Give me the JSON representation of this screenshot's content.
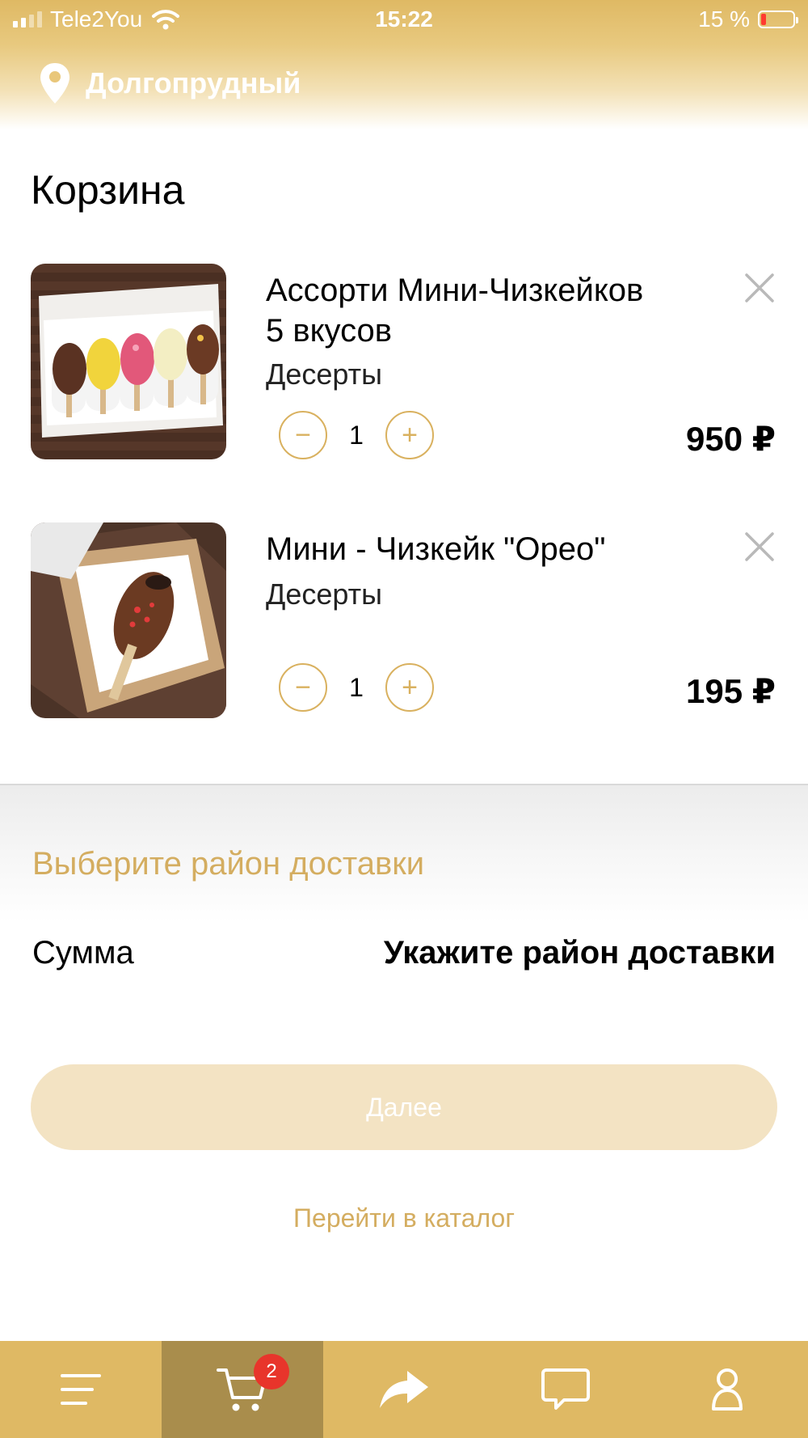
{
  "status_bar": {
    "carrier": "Tele2You",
    "time": "15:22",
    "battery": "15 %",
    "battery_level": 0.15
  },
  "header": {
    "city": "Долгопрудный"
  },
  "page": {
    "title": "Корзина"
  },
  "cart": {
    "items": [
      {
        "name_line1": "Ассорти Мини-Чизкейков",
        "name_line2": "5 вкусов",
        "category": "Десерты",
        "quantity": "1",
        "price": "950 ₽",
        "minus": "−",
        "plus": "+"
      },
      {
        "name_line1": "Мини - Чизкейк \"Орео\"",
        "category": "Десерты",
        "quantity": "1",
        "price": "195 ₽",
        "minus": "−",
        "plus": "+"
      }
    ]
  },
  "delivery": {
    "choose_district": "Выберите район доставки"
  },
  "summary": {
    "label": "Сумма",
    "value": "Укажите район доставки"
  },
  "actions": {
    "next": "Далее",
    "catalog": "Перейти в каталог"
  },
  "bottom_nav": {
    "items": [
      {
        "icon": "menu-icon"
      },
      {
        "icon": "cart-icon",
        "badge": "2",
        "active": true
      },
      {
        "icon": "share-icon"
      },
      {
        "icon": "chat-icon"
      },
      {
        "icon": "profile-icon"
      }
    ]
  },
  "colors": {
    "accent": "#dfb964",
    "accent_text": "#d4ad60",
    "nav_active": "#a98d4c",
    "badge": "#e8352b",
    "button_disabled": "#f3e3c3"
  }
}
